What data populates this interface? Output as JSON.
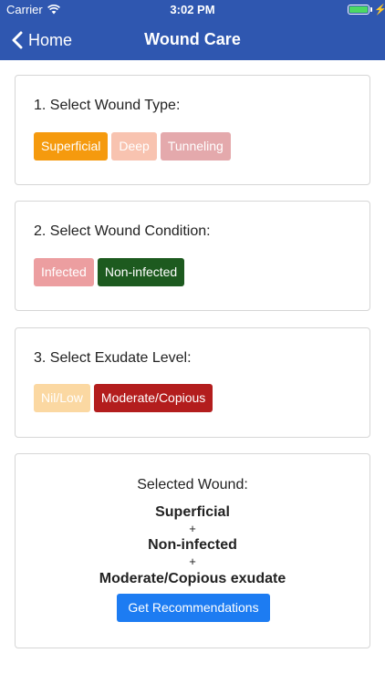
{
  "status_bar": {
    "carrier": "Carrier",
    "time": "3:02 PM",
    "battery_color": "#4cd964"
  },
  "nav": {
    "back_label": "Home",
    "title": "Wound Care",
    "background": "#2f57b0"
  },
  "wound_type": {
    "title": "1. Select Wound Type:",
    "options": [
      {
        "label": "Superficial",
        "color": "#f59a0e",
        "selected": true
      },
      {
        "label": "Deep",
        "color": "#f8c3b0",
        "selected": false
      },
      {
        "label": "Tunneling",
        "color": "#e4a9ac",
        "selected": false
      }
    ]
  },
  "wound_condition": {
    "title": "2. Select Wound Condition:",
    "options": [
      {
        "label": "Infected",
        "color": "#ec9ea0",
        "selected": false
      },
      {
        "label": "Non-infected",
        "color": "#1d5a1f",
        "selected": true
      }
    ]
  },
  "exudate_level": {
    "title": "3. Select Exudate Level:",
    "options": [
      {
        "label": "Nil/Low",
        "color": "#fbd8a2",
        "selected": false
      },
      {
        "label": "Moderate/Copious",
        "color": "#b31d1d",
        "selected": true
      }
    ]
  },
  "summary": {
    "title": "Selected Wound:",
    "line1": "Superficial",
    "plus1": "+",
    "line2": "Non-infected",
    "plus2": "+",
    "line3": "Moderate/Copious exudate",
    "button_label": "Get Recommendations",
    "button_color": "#1d7cf2"
  }
}
